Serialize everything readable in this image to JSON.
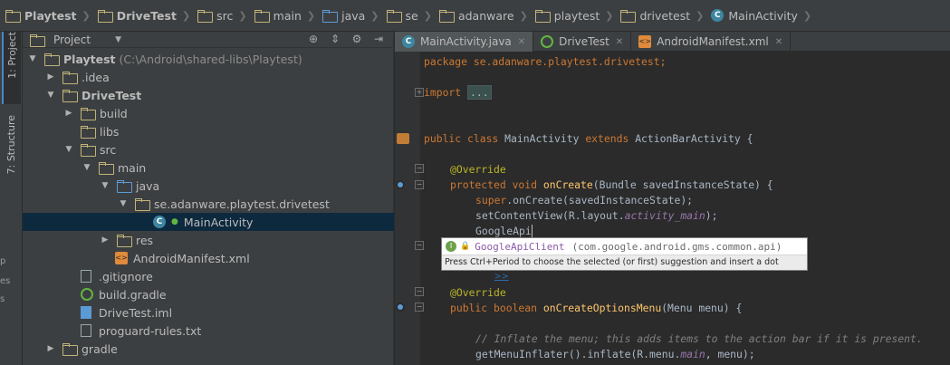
{
  "breadcrumb": [
    {
      "label": "Playtest",
      "icon": "folder-icon",
      "bold": true
    },
    {
      "label": "DriveTest",
      "icon": "folder-icon",
      "bold": true
    },
    {
      "label": "src",
      "icon": "folder-icon"
    },
    {
      "label": "main",
      "icon": "folder-icon"
    },
    {
      "label": "java",
      "icon": "source-folder-icon"
    },
    {
      "label": "se",
      "icon": "package-icon"
    },
    {
      "label": "adanware",
      "icon": "package-icon"
    },
    {
      "label": "playtest",
      "icon": "package-icon"
    },
    {
      "label": "drivetest",
      "icon": "package-icon"
    },
    {
      "label": "MainActivity",
      "icon": "class-icon"
    }
  ],
  "left_strip": {
    "project_tab": "1: Project",
    "structure_tab": "7: Structure",
    "fragments": [
      "p",
      "es",
      "s"
    ]
  },
  "project_panel": {
    "title": "Project",
    "tree": {
      "root": {
        "label": "Playtest",
        "path": "(C:\\Android\\shared-libs\\Playtest)"
      },
      "idea": ".idea",
      "drivetest": "DriveTest",
      "build": "build",
      "libs": "libs",
      "src": "src",
      "main": "main",
      "java": "java",
      "package": "se.adanware.playtest.drivetest",
      "mainactivity": "MainActivity",
      "res": "res",
      "manifest": "AndroidManifest.xml",
      "gitignore": ".gitignore",
      "buildgradle": "build.gradle",
      "iml": "DriveTest.iml",
      "proguard": "proguard-rules.txt",
      "gradle": "gradle"
    }
  },
  "editor": {
    "tabs": [
      {
        "label": "MainActivity.java",
        "active": true
      },
      {
        "label": "DriveTest",
        "active": false
      },
      {
        "label": "AndroidManifest.xml",
        "active": false
      }
    ],
    "code": {
      "l1": "package se.adanware.playtest.drivetest;",
      "l2_kw": "import",
      "l2_fold": "...",
      "l3_kw": "public class",
      "l3_name": "MainActivity",
      "l3_kw2": "extends",
      "l3_rest": "ActionBarActivity {",
      "l4": "@Override",
      "l5_kw": "protected void",
      "l5_fn": "onCreate",
      "l5_rest": "(Bundle savedInstanceState) {",
      "l6_kw": "super",
      "l6_rest": ".onCreate(savedInstanceState);",
      "l7_pre": "setContentView(R.layout.",
      "l7_it": "activity_main",
      "l7_post": ");",
      "l8": "GoogleApi",
      "l9": "@Override",
      "l10_kw": "public boolean",
      "l10_fn": "onCreateOptionsMenu",
      "l10_rest": "(Menu menu) {",
      "l11": "// Inflate the menu; this adds items to the action bar if it is present.",
      "l12_pre": "getMenuInflater().inflate(R.menu.",
      "l12_it": "main",
      "l12_post": ", menu);"
    }
  },
  "completion": {
    "badge": "I",
    "name": "GoogleApiClient",
    "package": "(com.google.android.gms.common.api)",
    "hint": "Press Ctrl+Period to choose the selected (or first) suggestion and insert a dot afterwards",
    "hint_link": ">>"
  }
}
